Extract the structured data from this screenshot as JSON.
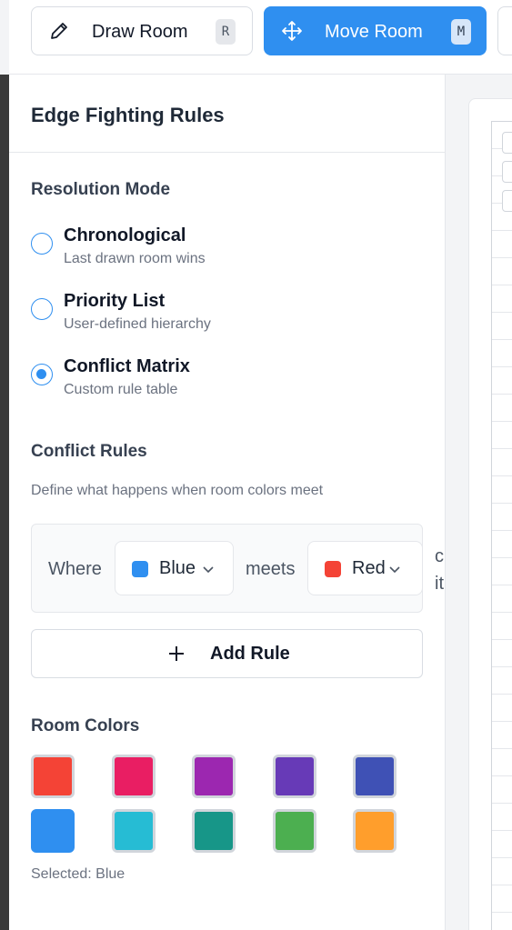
{
  "toolbar": {
    "draw": {
      "label": "Draw Room",
      "shortcut": "R",
      "icon": "pencil-icon"
    },
    "move": {
      "label": "Move Room",
      "shortcut": "M",
      "icon": "move-arrows-icon"
    }
  },
  "panel": {
    "title": "Edge Fighting Rules",
    "resolution": {
      "title": "Resolution Mode",
      "options": [
        {
          "title": "Chronological",
          "subtitle": "Last drawn room wins",
          "checked": false
        },
        {
          "title": "Priority List",
          "subtitle": "User-defined hierarchy",
          "checked": false
        },
        {
          "title": "Conflict Matrix",
          "subtitle": "Custom rule table",
          "checked": true
        }
      ]
    },
    "rules": {
      "title": "Conflict Rules",
      "hint": "Define what happens when room colors meet",
      "rule": {
        "prefix": "Where",
        "color_a": {
          "label": "Blue",
          "color": "#2f8ff0"
        },
        "connector": "meets",
        "color_b": {
          "label": "Red",
          "color": "#f44336"
        },
        "overflow_line1": "c",
        "overflow_line2": "it"
      },
      "add_label": "Add Rule"
    },
    "room_colors": {
      "title": "Room Colors",
      "colors": [
        "#f44336",
        "#e91e63",
        "#9c27b0",
        "#673ab7",
        "#3f51b5",
        "#2f8ff0",
        "#26bcd4",
        "#179688",
        "#4caf50",
        "#ff9e2c"
      ],
      "selected_index": 5,
      "selected_text": "Selected: Blue"
    }
  }
}
